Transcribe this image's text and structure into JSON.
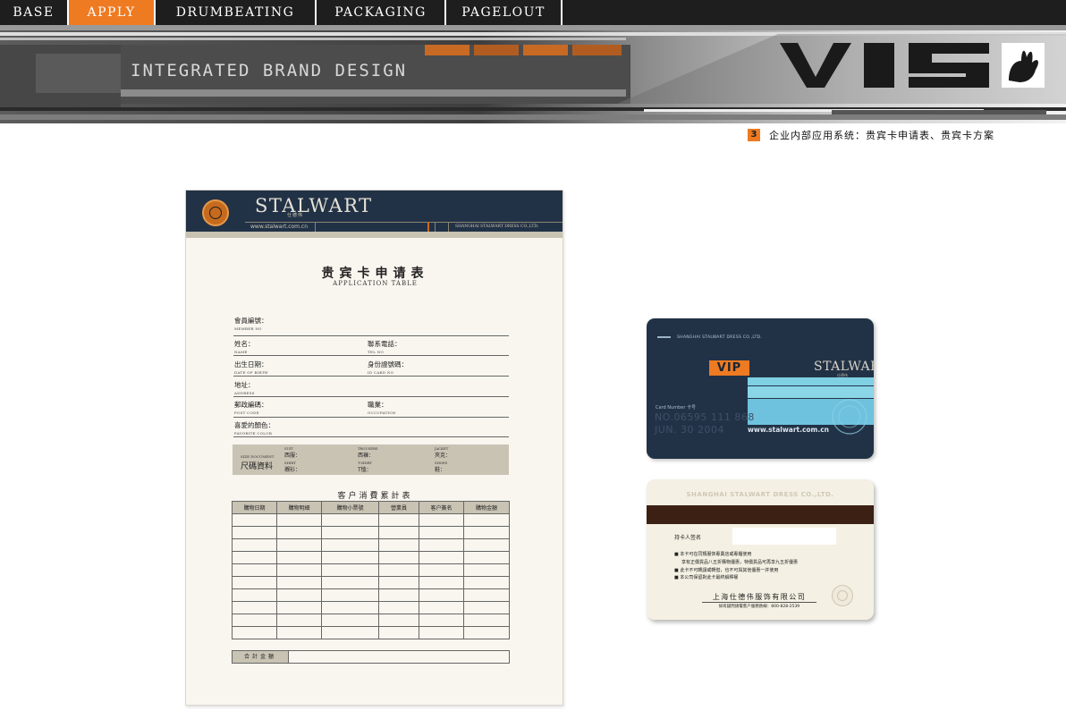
{
  "nav": {
    "tabs": [
      {
        "label": "BASE",
        "active": false
      },
      {
        "label": "APPLY",
        "active": true
      },
      {
        "label": "DRUMBEATING",
        "active": false
      },
      {
        "label": "PACKAGING",
        "active": false
      },
      {
        "label": "PAGELOUT",
        "active": false
      }
    ]
  },
  "banner": {
    "title": "INTEGRATED BRAND DESIGN",
    "logo_text": "VIS",
    "logo_icon": "hand-print-icon"
  },
  "section": {
    "number": "3",
    "caption": "企业内部应用系统：贵宾卡申请表、贵宾卡方案"
  },
  "form": {
    "header": {
      "brand": "STALWART",
      "brand_cn": "仕德伟",
      "url": "www.stalwart.com.cn",
      "company": "SHANGHAI STALWART DRESS CO.,LTD."
    },
    "title": "贵宾卡申请表",
    "subtitle": "APPLICATION TABLE",
    "fields": {
      "member_no": {
        "cn": "會員編號：",
        "en": "MEMBER NO"
      },
      "name": {
        "cn": "姓名：",
        "en": "NAME"
      },
      "tel": {
        "cn": "聯系電話：",
        "en": "TEL NO"
      },
      "dob": {
        "cn": "出生日期：",
        "en": "DATE OF BIRTH"
      },
      "id": {
        "cn": "身份證號碼：",
        "en": "ID CARD NO"
      },
      "address": {
        "cn": "地址：",
        "en": "ADDRESS"
      },
      "post": {
        "cn": "郵政編碼：",
        "en": "POST CODE"
      },
      "occupation": {
        "cn": "職業：",
        "en": "OCCUPATION"
      },
      "color": {
        "cn": "喜愛的顏色：",
        "en": "FAVORITE COLOR"
      }
    },
    "size": {
      "tag_en": "SIZE DOCUMENT",
      "tag_cn": "尺碼資料",
      "items": [
        {
          "en": "SUIT",
          "cn": "西服："
        },
        {
          "en": "TROUSERS",
          "cn": "西褲："
        },
        {
          "en": "JACKET",
          "cn": "夾克："
        },
        {
          "en": "SHIRT",
          "cn": "襯衫："
        },
        {
          "en": "T-SHIRT",
          "cn": "T恤："
        },
        {
          "en": "SHOES",
          "cn": "鞋："
        }
      ]
    },
    "ledger": {
      "title": "客户消費累計表",
      "columns": [
        "購物日期",
        "購物明細",
        "購物小票號",
        "營業員",
        "客户簽名",
        "購物金額"
      ],
      "total_label": "合計金額"
    }
  },
  "card_front": {
    "company": "SHANGHAI STALWART DRESS CO.,LTD.",
    "vip": "VIP",
    "brand": "STALWART",
    "brand_cn": "仕德伟",
    "card_number_label": "Card Number 卡号",
    "card_number": "NO.06595 111 868",
    "date": "JUN. 30 2004",
    "url": "www.stalwart.com.cn",
    "colors": {
      "navy": "#223246",
      "cyan": "#7fd0e3",
      "orange": "#ee7a22"
    }
  },
  "card_back": {
    "company": "SHANGHAI STALWART DRESS CO.,LTD.",
    "sign_label": "持卡人签名",
    "terms": [
      "■ 本卡可在同類服饰專賣店或專櫃使用",
      "享有正價貨品八五折購物優惠，特價貨品可再享九五折優惠",
      "■ 此卡不可轉讓或轉借，也不可與其他優惠一并使用",
      "■ 本公司保留對此卡最終解釋權"
    ],
    "signature_company": "上海仕德伟服饰有限公司",
    "hotline": "如有疑問請電客户服務熱線：800-828-2539"
  }
}
